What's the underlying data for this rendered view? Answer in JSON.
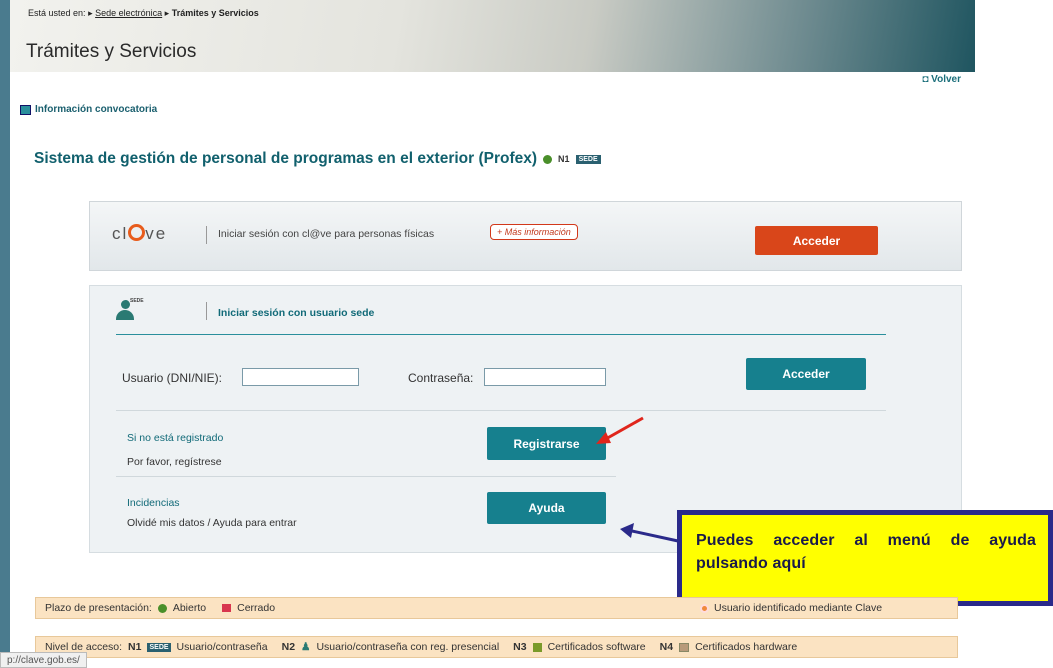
{
  "breadcrumb": {
    "prefix": "Está usted en:",
    "link": "Sede electrónica",
    "current": "Trámites y Servicios"
  },
  "page_title": "Trámites y Servicios",
  "volver": "Volver",
  "info_link": "Información convocatoria",
  "system_title": "Sistema de gestión de personal de programas en el exterior (Profex)",
  "system_level": "N1",
  "sede_badge": "SEDE",
  "clave": {
    "logo_pre": "cl",
    "logo_post": "ve",
    "text": "Iniciar sesión con cl@ve para personas físicas",
    "mas_info": "+ Más información",
    "button": "Acceder"
  },
  "sede": {
    "icon_label": "SEDE",
    "title": "Iniciar sesión con usuario sede",
    "user_label": "Usuario (DNI/NIE):",
    "user_value": "",
    "pass_label": "Contraseña:",
    "pass_value": "",
    "button": "Acceder",
    "register_title": "Si no está registrado",
    "register_sub": "Por favor, regístrese",
    "register_button": "Registrarse",
    "help_title": "Incidencias",
    "help_sub": "Olvidé mis datos / Ayuda para entrar",
    "help_button": "Ayuda"
  },
  "callout": "Puedes acceder al menú de ayuda pulsando aquí",
  "plazo": {
    "label": "Plazo de presentación:",
    "abierto": "Abierto",
    "cerrado": "Cerrado",
    "clave_user": "Usuario identificado mediante Clave"
  },
  "nivel": {
    "label": "Nivel de acceso:",
    "n1": "N1",
    "n1_badge": "SEDE",
    "n1_text": "Usuario/contraseña",
    "n2": "N2",
    "n2_text": "Usuario/contraseña con reg. presencial",
    "n3": "N3",
    "n3_text": "Certificados software",
    "n4": "N4",
    "n4_text": "Certificados hardware"
  },
  "status_url": "p://clave.gob.es/",
  "colors": {
    "teal": "#16808e",
    "orange": "#d9461a",
    "callout_bg": "#ffff00",
    "callout_border": "#2a2a8a"
  }
}
